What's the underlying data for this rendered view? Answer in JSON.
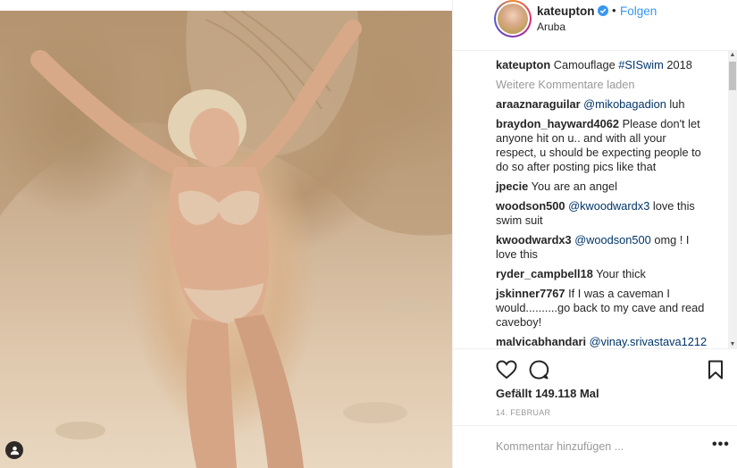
{
  "post": {
    "author": "kateupton",
    "location": "Aruba",
    "follow_label": "Folgen",
    "dot": "•"
  },
  "caption": {
    "user": "kateupton",
    "text_before": "Camouflage ",
    "hashtag": "#SISwim",
    "text_after": " 2018"
  },
  "load_more": "Weitere Kommentare laden",
  "comments": [
    {
      "user": "araaznaraguilar",
      "mention": "@mikobagadion",
      "text": " luh"
    },
    {
      "user": "braydon_hayward4062",
      "mention": "",
      "text": "Please don't let anyone hit on u.. and with all your respect, u should be expecting people to do so after posting pics like that"
    },
    {
      "user": "jpecie",
      "mention": "",
      "text": "You are an angel"
    },
    {
      "user": "woodson500",
      "mention": "@kwoodwardx3",
      "text": " love this swim suit"
    },
    {
      "user": "kwoodwardx3",
      "mention": "@woodson500",
      "text": " omg ! I love this"
    },
    {
      "user": "ryder_campbell18",
      "mention": "",
      "text": "Your thick"
    },
    {
      "user": "jskinner7767",
      "mention": "",
      "text": "If I was a caveman I would..........go back to my cave and read caveboy!"
    },
    {
      "user": "malvicabhandari",
      "mention": "@vinay.srivastava1212",
      "text": ""
    }
  ],
  "likes": {
    "prefix": "Gefällt ",
    "count": "149.118",
    "suffix": " Mal"
  },
  "date": "14. FEBRUAR",
  "add_comment": {
    "placeholder": "Kommentar hinzufügen ...",
    "more": "•••"
  },
  "icons": {
    "like": "heart-outline-icon",
    "comment": "speech-bubble-icon",
    "save": "bookmark-icon",
    "verified": "verified-badge-icon",
    "user_tag": "user-tag-icon"
  },
  "colors": {
    "link_blue": "#3897f0",
    "mention_blue": "#003569",
    "muted_gray": "#999999",
    "text": "#262626"
  }
}
